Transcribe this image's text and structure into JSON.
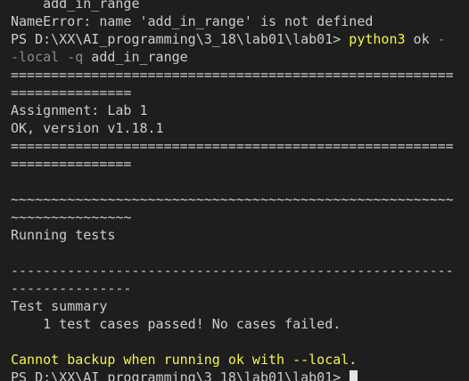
{
  "terminal": {
    "lines": {
      "l0": "    add_in_range",
      "l1": "NameError: name 'add_in_range' is not defined",
      "l2_prompt": "PS D:\\XX\\AI_programming\\3_18\\lab01\\lab01> ",
      "l2_cmd": "python3",
      "l2_arg": " ok",
      "l2_flag": " -",
      "l3_flag": "-local -q",
      "l3_arg": " add_in_range",
      "l4": "=======================================================",
      "l5": "===============",
      "l6": "Assignment: Lab 1",
      "l7": "OK, version v1.18.1",
      "l8": "=======================================================",
      "l9": "===============",
      "l10": "",
      "l11": "~~~~~~~~~~~~~~~~~~~~~~~~~~~~~~~~~~~~~~~~~~~~~~~~~~~~~~~",
      "l12": "~~~~~~~~~~~~~~~",
      "l13": "Running tests",
      "l14": "",
      "l15": "-------------------------------------------------------",
      "l16": "---------------",
      "l17": "Test summary",
      "l18": "    1 test cases passed! No cases failed.",
      "l19": "",
      "l20": "Cannot backup when running ok with --local.",
      "l21_prompt": "PS D:\\XX\\AI_programming\\3_18\\lab01\\lab01> "
    },
    "colors": {
      "background": "#1e1e1e",
      "text": "#cccccc",
      "command": "#f5f543",
      "flag": "#8a8a8a",
      "warning": "#f5f543"
    }
  }
}
